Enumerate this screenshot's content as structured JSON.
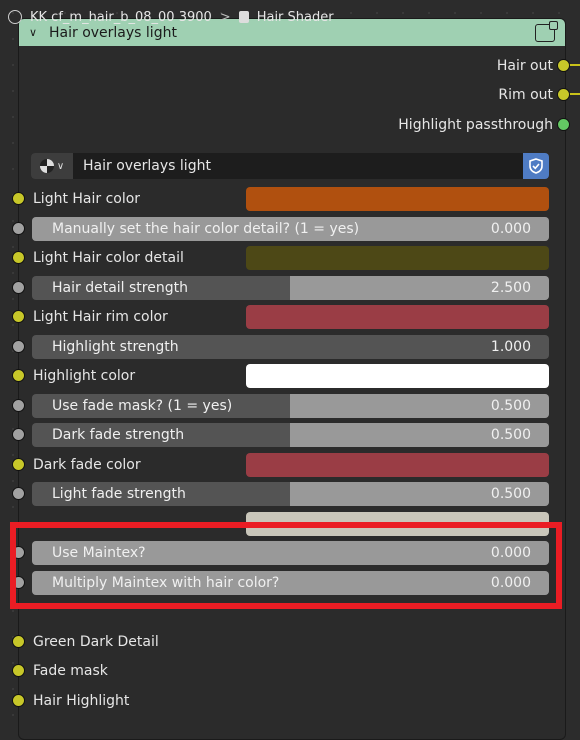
{
  "breadcrumb": {
    "object": "KK cf_m_hair_b_08_00 3900",
    "separator": ">",
    "material": "Hair Shader"
  },
  "node": {
    "title": "Hair overlays light",
    "outputs": [
      {
        "label": "Hair out",
        "socket_color": "#c7c729"
      },
      {
        "label": "Rim out",
        "socket_color": "#c7c729"
      },
      {
        "label": "Highlight passthrough",
        "socket_color": "#63c763"
      }
    ],
    "group_name": "Hair overlays light",
    "inputs": {
      "light_hair_color": {
        "label": "Light Hair color",
        "color": "#b0500f"
      },
      "manual_hair_detail": {
        "label": "Manually set the hair color detail? (1 = yes)",
        "value": "0.000",
        "fill": 1.0
      },
      "light_hair_color_detail": {
        "label": "Light Hair color detail",
        "color": "#4d4816"
      },
      "hair_detail_strength": {
        "label": "Hair detail strength",
        "value": "2.500",
        "fill": 0.5
      },
      "light_hair_rim_color": {
        "label": "Light Hair rim color",
        "color": "#9a3d45"
      },
      "highlight_strength": {
        "label": "Highlight strength",
        "value": "1.000",
        "fill": 0.0
      },
      "highlight_color": {
        "label": "Highlight color",
        "color": "#ffffff"
      },
      "use_fade_mask": {
        "label": "Use fade mask? (1 = yes)",
        "value": "0.500",
        "fill": 0.5
      },
      "dark_fade_strength": {
        "label": "Dark fade strength",
        "value": "0.500",
        "fill": 0.5
      },
      "dark_fade_color": {
        "label": "Dark fade color",
        "color": "#9a3d45"
      },
      "light_fade_strength": {
        "label": "Light fade strength",
        "value": "0.500",
        "fill": 0.5
      },
      "light_fade_color": {
        "color": "#c9c6ba"
      },
      "use_maintex": {
        "label": "Use Maintex?",
        "value": "0.000",
        "fill": 1.0
      },
      "multiply_maintex": {
        "label": "Multiply Maintex with hair color?",
        "value": "0.000",
        "fill": 1.0
      },
      "green_dark_detail": {
        "label": "Green Dark Detail"
      },
      "fade_mask": {
        "label": "Fade mask"
      },
      "hair_highlight": {
        "label": "Hair Highlight"
      }
    }
  },
  "colors": {
    "header": "#9fd0b2",
    "highlight_box": "#ea1d24",
    "socket_color": "#c7c729",
    "socket_float": "#a1a1a1",
    "socket_shader": "#63c763"
  }
}
